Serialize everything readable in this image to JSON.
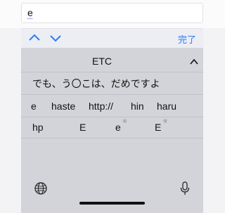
{
  "input": {
    "value": "e"
  },
  "toolbar": {
    "done_label": "完了"
  },
  "candidates": {
    "header_label": "ETC",
    "sentence": "でも、う〇こは、だめですよ",
    "row3": [
      "e",
      "haste",
      "http://",
      "hin",
      "haru"
    ],
    "row4": [
      "hp",
      "E",
      "e",
      "E"
    ],
    "row4_marks": [
      "",
      "",
      "※",
      "※"
    ]
  },
  "icons": {
    "up": "chevron-up-icon",
    "down": "chevron-down-icon",
    "collapse": "chevron-up-icon",
    "globe": "globe-icon",
    "mic": "microphone-icon"
  },
  "colors": {
    "accent": "#2f7bf6",
    "keyboard_bg": "#d2d4d9",
    "toolbar_bg": "#eceef3"
  }
}
